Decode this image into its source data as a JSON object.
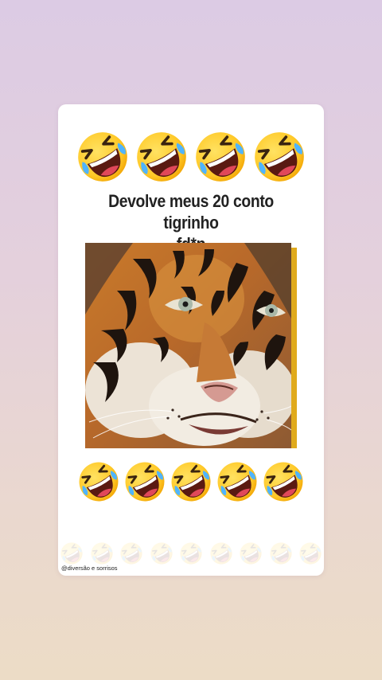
{
  "post": {
    "top_emojis": [
      "rolling-on-floor-laughing-emoji",
      "rolling-on-floor-laughing-emoji",
      "rolling-on-floor-laughing-emoji",
      "rolling-on-floor-laughing-emoji"
    ],
    "caption_line1": "Devolve meus 20 conto tigrinho",
    "caption_line2": "fd*p",
    "image": {
      "subject": "tiger-face",
      "accent_color": "#e0aa1c"
    },
    "bottom_emojis": [
      "rolling-on-floor-laughing-emoji",
      "rolling-on-floor-laughing-emoji",
      "rolling-on-floor-laughing-emoji",
      "rolling-on-floor-laughing-emoji",
      "rolling-on-floor-laughing-emoji"
    ],
    "watermark": "@diversão e sorrisos"
  },
  "colors": {
    "background_top": "#dccbe4",
    "background_bottom": "#ecdcc6",
    "card": "#ffffff",
    "emoji_yellow": "#ffc928",
    "text": "#222222"
  }
}
